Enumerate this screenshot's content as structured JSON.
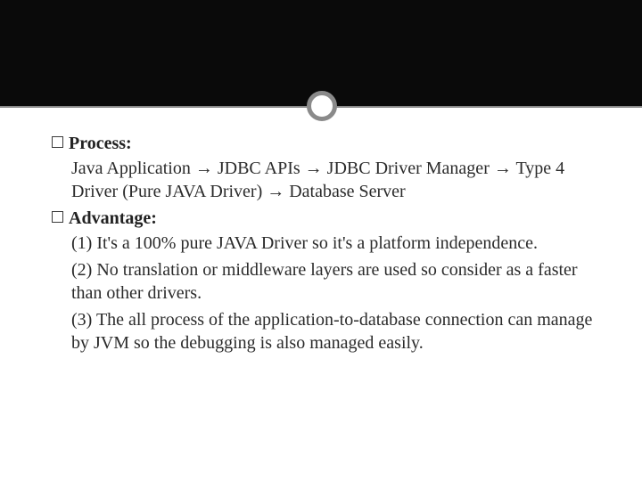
{
  "slide": {
    "sections": [
      {
        "label": "Process:",
        "body": "Java Application   → JDBC APIs     → JDBC Driver Manager →   Type 4 Driver (Pure JAVA Driver)   →   Database Server"
      },
      {
        "label": "Advantage:",
        "points": [
          "(1)   It's a 100% pure JAVA Driver so it's a platform independence.",
          "(2)   No translation or middleware layers are used so consider as a faster than other drivers.",
          "(3)   The all process of the application-to-database connection can manage by JVM so the debugging is also managed easily."
        ]
      }
    ]
  }
}
